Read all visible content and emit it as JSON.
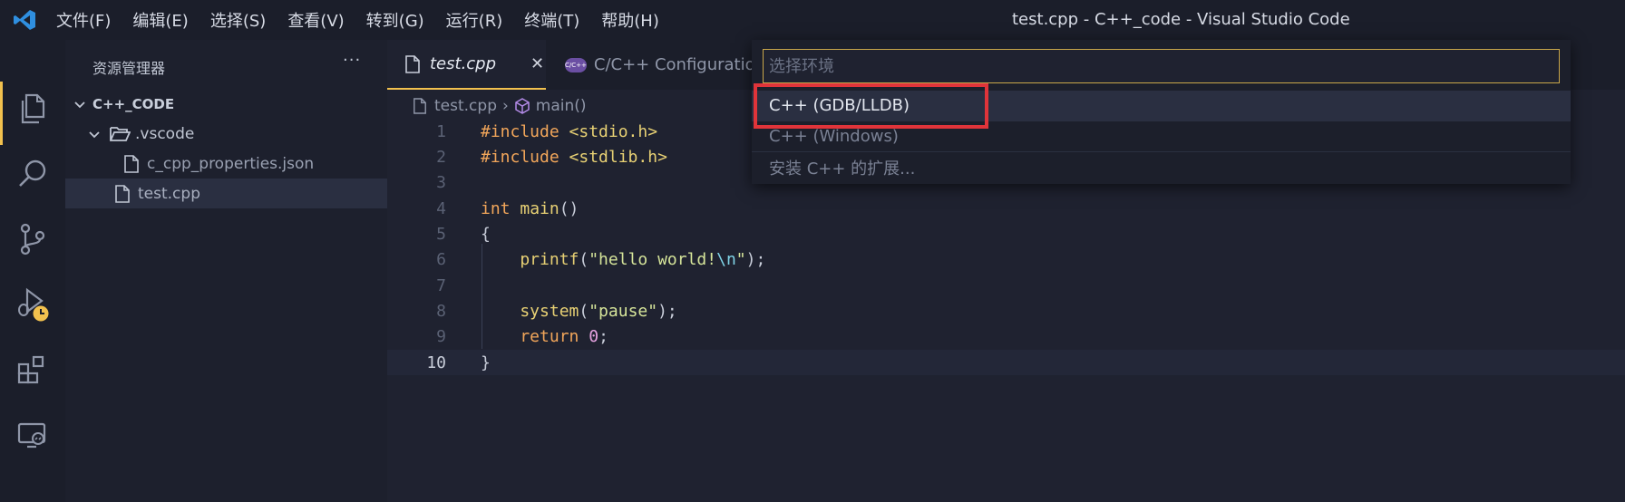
{
  "titlebar": {
    "menu": [
      "文件(F)",
      "编辑(E)",
      "选择(S)",
      "查看(V)",
      "转到(G)",
      "运行(R)",
      "终端(T)",
      "帮助(H)"
    ],
    "window_title": "test.cpp - C++_code - Visual Studio Code"
  },
  "activitybar": {
    "icons": [
      "explorer-icon",
      "search-icon",
      "source-control-icon",
      "run-debug-icon",
      "extensions-icon",
      "remote-explorer-icon"
    ]
  },
  "sidebar": {
    "title": "资源管理器",
    "more": "···",
    "tree": {
      "root": "C++_CODE",
      "folder": ".vscode",
      "folder_file": "c_cpp_properties.json",
      "file": "test.cpp"
    }
  },
  "tabs": [
    {
      "label": "test.cpp",
      "close": "✕"
    },
    {
      "label": "C/C++ Configuration",
      "icon_text": "C/C++"
    }
  ],
  "breadcrumb": {
    "file": "test.cpp",
    "sep": "›",
    "symbol": "main()"
  },
  "code": {
    "line_numbers": [
      "1",
      "2",
      "3",
      "4",
      "5",
      "6",
      "7",
      "8",
      "9",
      "10"
    ],
    "l1_a": "#include",
    "l1_b": " <stdio.h>",
    "l2_a": "#include",
    "l2_b": " <stdlib.h>",
    "l4_a": "int",
    "l4_b": " main",
    "l4_c": "()",
    "l5": "{",
    "l6_a": "    printf",
    "l6_b": "(",
    "l6_c": "\"hello world!",
    "l6_d": "\\n",
    "l6_e": "\"",
    "l6_f": ");",
    "l8_a": "    system",
    "l8_b": "(",
    "l8_c": "\"pause\"",
    "l8_d": ");",
    "l9_a": "    return",
    "l9_b": " 0",
    "l9_c": ";",
    "l10": "}"
  },
  "quickpick": {
    "placeholder": "选择环境",
    "items": [
      "C++ (GDB/LLDB)",
      "C++ (Windows)",
      "安装 C++ 的扩展..."
    ]
  },
  "colors": {
    "accent": "#f2c14e",
    "highlight_box": "#e0343a",
    "vscode_blue": "#2f8fe0"
  }
}
